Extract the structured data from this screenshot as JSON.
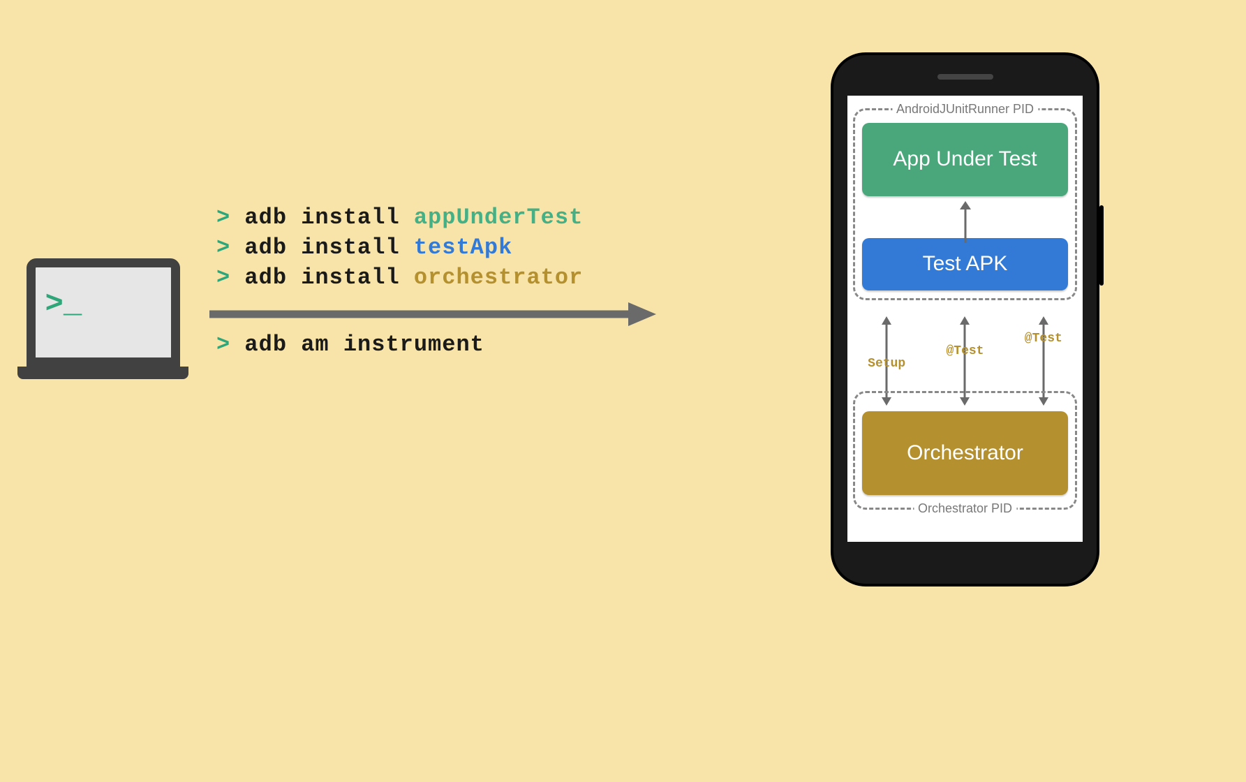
{
  "laptop": {
    "prompt": ">_"
  },
  "commands": {
    "l1": {
      "prefix": ">",
      "cmd": "adb install",
      "arg": "appUnderTest",
      "arg_color": "green"
    },
    "l2": {
      "prefix": ">",
      "cmd": "adb install",
      "arg": "testApk",
      "arg_color": "blue"
    },
    "l3": {
      "prefix": ">",
      "cmd": "adb install",
      "arg": "orchestrator",
      "arg_color": "gold"
    },
    "l4": {
      "prefix": ">",
      "cmd": "adb am instrument"
    }
  },
  "phone": {
    "pid_top_label": "AndroidJUnitRunner PID",
    "pid_bottom_label": "Orchestrator PID",
    "block_app": "App Under Test",
    "block_test": "Test APK",
    "block_orch": "Orchestrator",
    "conn": {
      "setup": "Setup",
      "t1": "@Test",
      "t2": "@Test"
    }
  },
  "colors": {
    "bg": "#f8e4a8",
    "green": "#4aa77b",
    "blue": "#327ad5",
    "gold": "#b5902e",
    "dark": "#414141"
  }
}
